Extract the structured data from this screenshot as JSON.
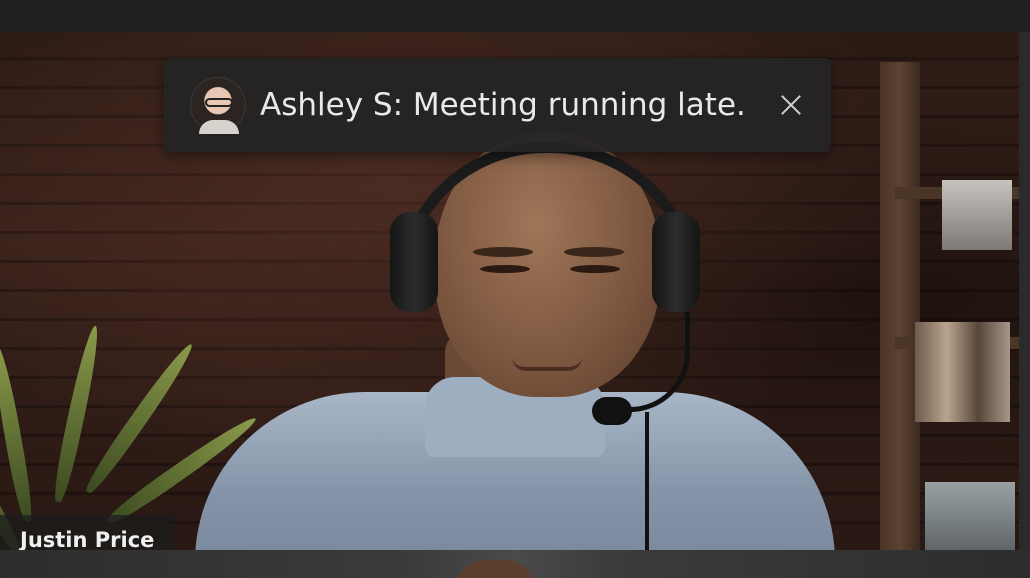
{
  "notification": {
    "sender": "Ashley S",
    "message": "Ashley S: Meeting running late.",
    "avatar_icon": "avatar-photo",
    "close_icon": "close-icon"
  },
  "participant": {
    "name": "Justin Price"
  }
}
